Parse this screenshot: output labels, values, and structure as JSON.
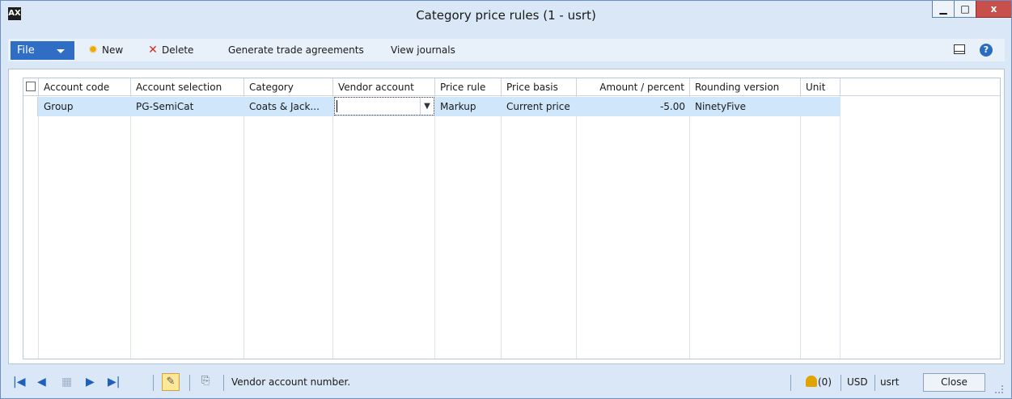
{
  "window": {
    "title": "Category price rules (1 - usrt)",
    "controls": {
      "minimize": "▁",
      "maximize": "□",
      "close": "x"
    },
    "app_icon_label": "AX"
  },
  "toolbar": {
    "file_label": "File",
    "new_label": "New",
    "delete_label": "Delete",
    "generate_label": "Generate trade agreements",
    "view_journals_label": "View journals",
    "icons": {
      "new": "sun-icon",
      "delete": "x-icon",
      "layout": "layout-icon",
      "help": "help-icon"
    },
    "help_label": "?"
  },
  "grid": {
    "columns": [
      "Account code",
      "Account selection",
      "Category",
      "Vendor account",
      "Price rule",
      "Price basis",
      "Amount / percent",
      "Rounding version",
      "Unit"
    ],
    "rows": [
      {
        "account_code": "Group",
        "account_selection": "PG-SemiCat",
        "category": "Coats & Jack...",
        "vendor_account": "",
        "price_rule": "Markup",
        "price_basis": "Current price",
        "amount_percent": "-5.00",
        "rounding_version": "NinetyFive",
        "unit": ""
      }
    ]
  },
  "statusbar": {
    "nav": {
      "first": "◀◀",
      "prev": "◀",
      "grid": "▦",
      "next": "▶",
      "last": "▶▶"
    },
    "message": "Vendor account number.",
    "notifications": "(0)",
    "currency": "USD",
    "company": "usrt",
    "close_label": "Close"
  },
  "colors": {
    "accent": "#2f6ec4",
    "selected_row": "#cfe6fb",
    "frame": "#d9e7f6",
    "close_red": "#c7504c"
  }
}
